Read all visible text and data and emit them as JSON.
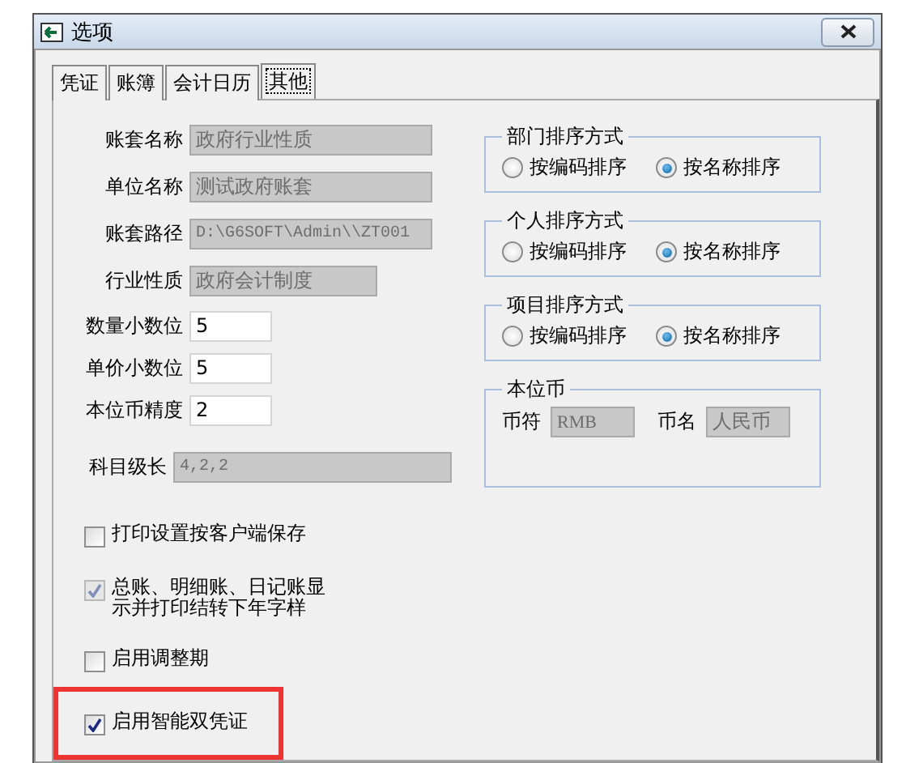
{
  "window": {
    "title": "选项"
  },
  "tabs": [
    {
      "label": "凭证",
      "selected": false
    },
    {
      "label": "账簿",
      "selected": false
    },
    {
      "label": "会计日历",
      "selected": false
    },
    {
      "label": "其他",
      "selected": true
    }
  ],
  "fields": [
    {
      "label": "账套名称",
      "value": "政府行业性质",
      "disabled": true
    },
    {
      "label": "单位名称",
      "value": "测试政府账套",
      "disabled": true
    },
    {
      "label": "账套路径",
      "value": "D:\\G6SOFT\\Admin\\\\ZT001",
      "disabled": true
    },
    {
      "label": "行业性质",
      "value": "政府会计制度",
      "disabled": true
    },
    {
      "label": "数量小数位",
      "value": "5",
      "disabled": false
    },
    {
      "label": "单价小数位",
      "value": "5",
      "disabled": false
    },
    {
      "label": "本位币精度",
      "value": "2",
      "disabled": false
    },
    {
      "label": "科目级长",
      "value": "4,2,2",
      "disabled": true
    }
  ],
  "checkboxes": [
    {
      "label": "打印设置按客户端保存",
      "checked": false,
      "disabled": false,
      "highlighted": false
    },
    {
      "label": "总账、明细账、日记账显示并打印结转下年字样",
      "checked": true,
      "disabled": true,
      "highlighted": false
    },
    {
      "label": "启用调整期",
      "checked": false,
      "disabled": false,
      "highlighted": false
    },
    {
      "label": "启用智能双凭证",
      "checked": true,
      "disabled": false,
      "highlighted": true
    }
  ],
  "sort_groups": [
    {
      "title": "部门排序方式",
      "options": [
        {
          "label": "按编码排序",
          "selected": false
        },
        {
          "label": "按名称排序",
          "selected": true
        }
      ]
    },
    {
      "title": "个人排序方式",
      "options": [
        {
          "label": "按编码排序",
          "selected": false
        },
        {
          "label": "按名称排序",
          "selected": true
        }
      ]
    },
    {
      "title": "项目排序方式",
      "options": [
        {
          "label": "按编码排序",
          "selected": false
        },
        {
          "label": "按名称排序",
          "selected": true
        }
      ]
    }
  ],
  "currency": {
    "title": "本位币",
    "symbol_label": "币符",
    "symbol_value": "RMB",
    "name_label": "币名",
    "name_value": "人民币"
  }
}
